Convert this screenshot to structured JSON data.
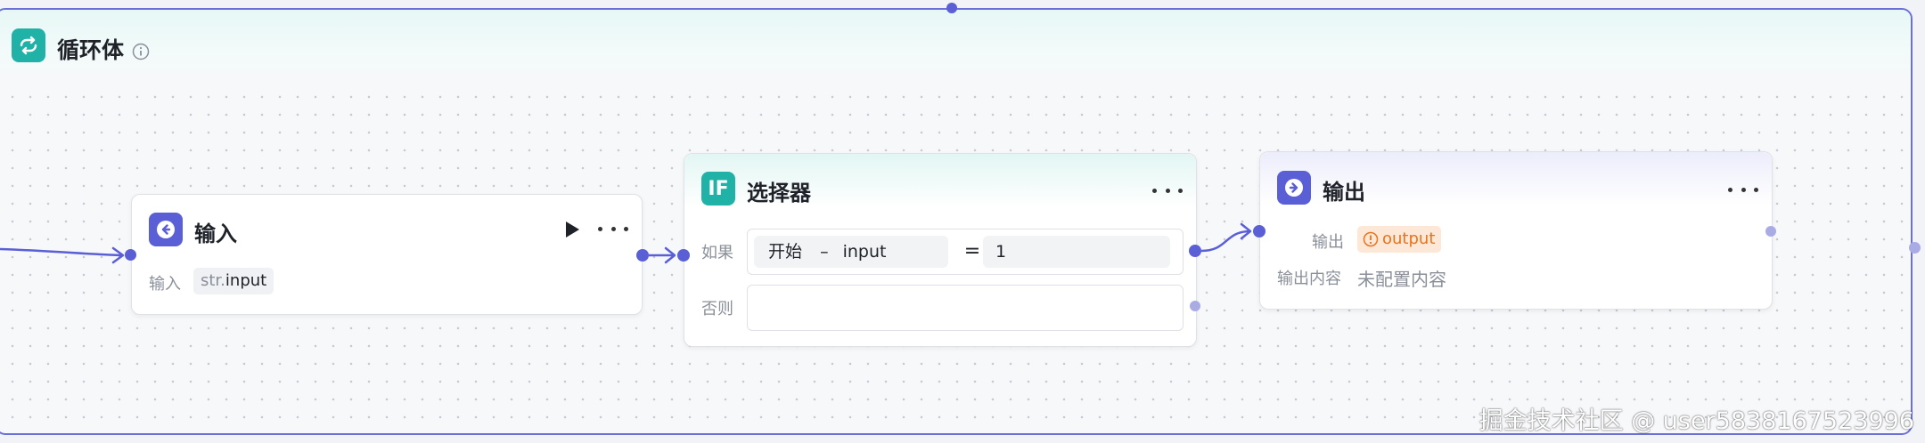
{
  "loop": {
    "title": "循环体"
  },
  "nodes": {
    "input": {
      "title": "输入",
      "field_label": "输入",
      "tag_prefix": "str.",
      "tag_value": "input"
    },
    "selector": {
      "title": "选择器",
      "icon_text": "IF",
      "if_label": "如果",
      "else_label": "否则",
      "condition_left_a": "开始",
      "condition_sep": "–",
      "condition_left_b": "input",
      "condition_op": "=",
      "condition_right": "1"
    },
    "output": {
      "title": "输出",
      "output_label": "输出",
      "output_tag": "output",
      "content_label": "输出内容",
      "content_value": "未配置内容"
    }
  },
  "watermark": "掘金技术社区 @ user5838167523996",
  "colors": {
    "accent": "#5a5fd6",
    "teal": "#20b2a6",
    "warning": "#e8741c"
  },
  "icons": [
    "loop-icon",
    "info-icon",
    "input-node-icon",
    "run-icon",
    "more-icon",
    "if-icon",
    "output-node-icon",
    "warning-icon"
  ]
}
